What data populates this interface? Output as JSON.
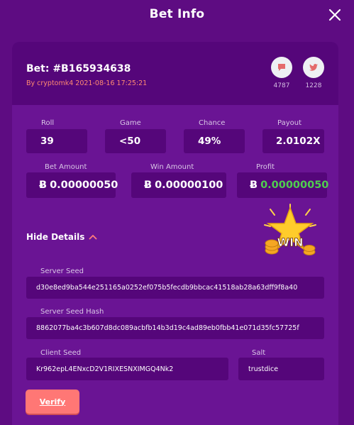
{
  "header": {
    "title": "Bet Info"
  },
  "bet": {
    "id_label": "Bet: #B165934638",
    "by_line": "By cryptomk4 2021-08-16 17:25:21",
    "chat_count": "4787",
    "twitter_count": "1228"
  },
  "stats": {
    "roll_label": "Roll",
    "roll_value": "39",
    "game_label": "Game",
    "game_value": "<50",
    "chance_label": "Chance",
    "chance_value": "49%",
    "payout_label": "Payout",
    "payout_value": "2.0102X",
    "bet_amount_label": "Bet Amount",
    "bet_amount_value": "0.00000050",
    "win_amount_label": "Win Amount",
    "win_amount_value": "0.00000100",
    "profit_label": "Profit",
    "profit_value": "0.00000050",
    "currency_symbol": "Ƀ"
  },
  "details": {
    "toggle_label": "Hide Details",
    "win_badge": "WIN",
    "server_seed_label": "Server Seed",
    "server_seed_value": "d30e8ed9ba544e251165a0252ef075b5fecdb9bbcac41518ab28a63dff9f8a40",
    "server_seed_hash_label": "Server Seed Hash",
    "server_seed_hash_value": "8862077ba4c3b607d8dc089acbfb14b3d19c4ad89eb0fbb41e071d35fc57725f",
    "client_seed_label": "Client Seed",
    "client_seed_value": "Kr962epL4ENxcD2V1RIXESNXIMGQ4Nk2",
    "salt_label": "Salt",
    "salt_value": "trustdice",
    "verify_label": "Verify"
  },
  "colors": {
    "background": "#5e0c82",
    "card": "#6a1494",
    "field": "#55067a",
    "accent": "#ff7775",
    "profit": "#4fcf4f"
  }
}
